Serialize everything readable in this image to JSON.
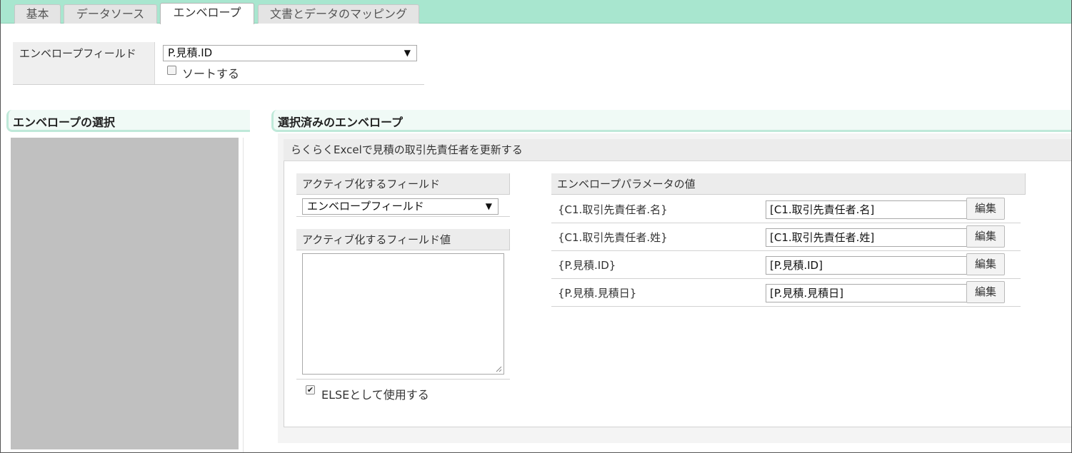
{
  "tabs": [
    {
      "label": "基本"
    },
    {
      "label": "データソース"
    },
    {
      "label": "エンベロープ"
    },
    {
      "label": "文書とデータのマッピング"
    }
  ],
  "envelope_field": {
    "label": "エンベロープフィールド",
    "selected": "P.見積.ID",
    "sort_label": "ソートする",
    "sort_checked": false
  },
  "left_section": {
    "title": "エンベロープの選択"
  },
  "right_section": {
    "title": "選択済みのエンベロープ",
    "envelope_title": "らくらくExcelで見積の取引先責任者を更新する",
    "activate_field_label": "アクティブ化するフィールド",
    "activate_field_selected": "エンベロープフィールド",
    "activate_value_label": "アクティブ化するフィールド値",
    "activate_value_text": "",
    "else_label": "ELSEとして使用する",
    "else_checked": true,
    "params_header": "エンベロープパラメータの値",
    "edit_label": "編集",
    "params": [
      {
        "name": "{C1.取引先責任者.名}",
        "value": "[C1.取引先責任者.名]"
      },
      {
        "name": "{C1.取引先責任者.姓}",
        "value": "[C1.取引先責任者.姓]"
      },
      {
        "name": "{P.見積.ID}",
        "value": "[P.見積.ID]"
      },
      {
        "name": "{P.見積.見積日}",
        "value": "[P.見積.見積日]"
      }
    ]
  }
}
